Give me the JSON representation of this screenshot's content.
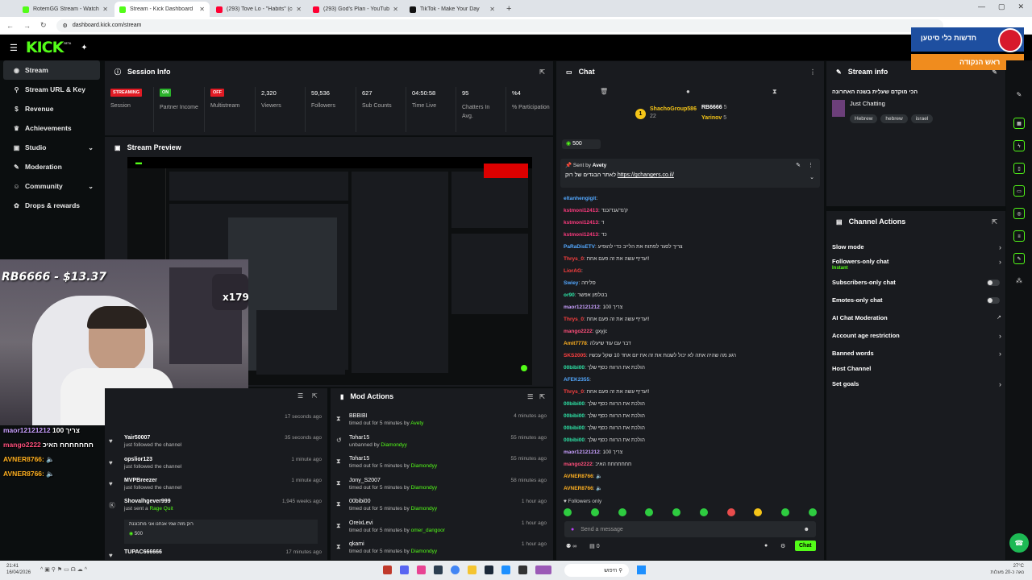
{
  "browser": {
    "tabs": [
      {
        "title": "RotemGG Stream - Watch Live",
        "color": "#53fc18"
      },
      {
        "title": "Stream - Kick Dashboard",
        "color": "#53fc18"
      },
      {
        "title": "(293) Tove Lo - \"Habits\" (cove",
        "color": "#ff0033"
      },
      {
        "title": "(293) God's Plan - YouTube",
        "color": "#ff0033"
      },
      {
        "title": "TikTok - Make Your Day",
        "color": "#111111"
      }
    ],
    "new_tab": "+",
    "url": "dashboard.kick.com/stream"
  },
  "header": {
    "logo": "KICK",
    "logo_beta": "BETA"
  },
  "sidebar": {
    "items": [
      {
        "label": "Stream",
        "icon": "broadcast-icon",
        "glyph": "◉"
      },
      {
        "label": "Stream URL & Key",
        "icon": "key-icon",
        "glyph": "⚲"
      },
      {
        "label": "Revenue",
        "icon": "money-icon",
        "glyph": "$"
      },
      {
        "label": "Achievements",
        "icon": "trophy-icon",
        "glyph": "♛"
      },
      {
        "label": "Studio",
        "icon": "studio-icon",
        "glyph": "▣"
      },
      {
        "label": "Moderation",
        "icon": "sword-icon",
        "glyph": "✎"
      },
      {
        "label": "Community",
        "icon": "people-icon",
        "glyph": "☺"
      },
      {
        "label": "Drops & rewards",
        "icon": "gift-icon",
        "glyph": "✿"
      }
    ]
  },
  "session": {
    "title": "Session Info",
    "stats": [
      {
        "badge": "STREAMING",
        "badge_color": "#e01b24",
        "label": "Session"
      },
      {
        "badge": "ON",
        "badge_color": "#2bb32b",
        "label": "Partner Income"
      },
      {
        "badge": "OFF",
        "badge_color": "#e01b24",
        "label": "Multistream"
      },
      {
        "value": "2,320",
        "label": "Viewers"
      },
      {
        "value": "59,536",
        "label": "Followers"
      },
      {
        "value": "627",
        "label": "Sub Counts"
      },
      {
        "value": "04:50:58",
        "label": "Time Live"
      },
      {
        "value": "95",
        "label": "Chatters In Avg."
      },
      {
        "value": "%4",
        "label": "% Participation"
      }
    ]
  },
  "preview": {
    "title": "Stream Preview"
  },
  "webcam": {
    "overlay": "RB6666 - $13.37",
    "counter": "x1792"
  },
  "activity": {
    "overlay_chat": [
      {
        "user": "maor12121212",
        "text": "100 צריך",
        "color": "#c9a0ff"
      },
      {
        "user": "mango2222",
        "text": "חחחחחחח האיכ",
        "color": "#ff4f7b"
      },
      {
        "user": "AVNER8766:",
        "text": "🔈",
        "color": "#ffb020"
      },
      {
        "user": "AVNER8766:",
        "text": "🔈",
        "color": "#ffb020"
      }
    ],
    "items": [
      {
        "name": "",
        "sub": "",
        "time": "17 seconds ago"
      },
      {
        "name": "Yair50007",
        "sub": "just followed the channel",
        "time": "35 seconds ago"
      },
      {
        "name": "opslior123",
        "sub": "just followed the channel",
        "time": "1 minute ago"
      },
      {
        "name": "MVPBreezer",
        "sub": "just followed the channel",
        "time": "1 minute ago"
      },
      {
        "name": "Shovalhgever999",
        "sub": "just sent a",
        "gift": "Rage Quit",
        "time": "1,945 weeks ago"
      },
      {
        "name": "TUPAC666666",
        "sub": "",
        "time": "17 minutes ago"
      }
    ],
    "gift_message": "רוק מזה שמי אנחנו אני מתכוננת",
    "gift_amount": "500"
  },
  "mod_actions": {
    "title": "Mod Actions",
    "items": [
      {
        "name": "BBBIBI",
        "sub": "timed out for 5 minutes by",
        "by": "Avety",
        "time": "4 minutes ago",
        "icon": "hourglass-icon"
      },
      {
        "name": "Tohar15",
        "sub": "unbanned by",
        "by": "Diamondyy",
        "time": "55 minutes ago",
        "icon": "undo-icon"
      },
      {
        "name": "Tohar15",
        "sub": "timed out for 5 minutes by",
        "by": "Diamondyy",
        "time": "55 minutes ago",
        "icon": "hourglass-icon"
      },
      {
        "name": "Jony_S2007",
        "sub": "timed out for 5 minutes by",
        "by": "Diamondyy",
        "time": "58 minutes ago",
        "icon": "hourglass-icon"
      },
      {
        "name": "00bibi00",
        "sub": "timed out for 5 minutes by",
        "by": "Diamondyy",
        "time": "1 hour ago",
        "icon": "hourglass-icon"
      },
      {
        "name": "OreixLevi",
        "sub": "timed out for 5 minutes by",
        "by": "omer_dangoor",
        "time": "1 hour ago",
        "icon": "hourglass-icon"
      },
      {
        "name": "qkami",
        "sub": "timed out for 5 minutes by",
        "by": "Diamondyy",
        "time": "1 hour ago",
        "icon": "hourglass-icon"
      }
    ]
  },
  "chat": {
    "title": "Chat",
    "top_user1": "ShachoGroup586",
    "top_user1_count": "22",
    "top_user2": "RB6666",
    "top_user2_count": "5",
    "top_user3": "Yarinov",
    "top_user3_count": "5",
    "rank": "1",
    "pinned_amount": "500",
    "pinned_by_label": "Sent by",
    "pinned_by": "Avety",
    "pinned_text": "לאתר הבגדים של רוק",
    "pinned_link": "https://gchangers.co.il/",
    "messages": [
      {
        "user": "eltanhengigit",
        "text": "",
        "color": "#53a8ff"
      },
      {
        "user": "kstmoni12413",
        "text": "ק'נד/גנד/כנד",
        "color": "#ff3b7f"
      },
      {
        "user": "kstmoni12413",
        "text": "ד",
        "color": "#ff3b7f"
      },
      {
        "user": "kstmoni12413",
        "text": "כד",
        "color": "#ff3b7f"
      },
      {
        "user": "PaRaDisETV",
        "text": "צריך לסגר לפתוח את הלייב כדי להופיע",
        "color": "#53a8ff"
      },
      {
        "user": "Thrys_0",
        "text": "עדיף עשה את זה פעם אחת!!",
        "color": "#ff4040"
      },
      {
        "user": "LiorAG",
        "text": "",
        "color": "#ff4040"
      },
      {
        "user": "Swiey",
        "text": "סליחה",
        "color": "#53a8ff"
      },
      {
        "user": "or90",
        "text": "בטלפון אפשר",
        "color": "#2ee6a8"
      },
      {
        "user": "maor12121212",
        "text": "100 צריך",
        "color": "#c9a0ff"
      },
      {
        "user": "Thrys_0",
        "text": "עדיף עשה את זה פעם אחת!!",
        "color": "#ff4040"
      },
      {
        "user": "mango2222",
        "text": "gxyjc",
        "color": "#ff4f7b"
      },
      {
        "user": "Amit7778",
        "text": "דבר עם עוד שיעלה",
        "color": "#ffb020"
      },
      {
        "user": "SKS2005",
        "text": "רגע מה שהיה אתה לא יכול לשנות את זה את יום אחד 10 שקל עכשיו",
        "color": "#ff4040"
      },
      {
        "user": "00bibi00",
        "text": "הולכת את הרווח כסף שלך",
        "color": "#2ee6a8"
      },
      {
        "user": "AFEK2355",
        "text": "",
        "color": "#53a8ff"
      },
      {
        "user": "Thrys_0",
        "text": "עדיף עשה את זה פעם אחת!!",
        "color": "#ff4040"
      },
      {
        "user": "00bibi00",
        "text": "הולכת את הרווח כסף שלך",
        "color": "#2ee6a8"
      },
      {
        "user": "00bibi00",
        "text": "הולכת את הרווח כסף שלך",
        "color": "#2ee6a8"
      },
      {
        "user": "00bibi00",
        "text": "הולכת את הרווח כסף שלך",
        "color": "#2ee6a8"
      },
      {
        "user": "00bibi00",
        "text": "הולכת את הרווח כסף שלך",
        "color": "#2ee6a8"
      },
      {
        "user": "maor12121212",
        "text": "100 צריך",
        "color": "#c9a0ff"
      },
      {
        "user": "mango2222",
        "text": "חחחחחחח האיכ",
        "color": "#ff4f7b"
      },
      {
        "user": "AVNER8766",
        "text": "🔈",
        "color": "#ffb020"
      },
      {
        "user": "AVNER8766",
        "text": "🔈",
        "color": "#ffb020"
      }
    ],
    "followers_only": "Followers only",
    "placeholder": "Send a message",
    "viewers_count": "0",
    "chat_button": "Chat"
  },
  "stream_info": {
    "title": "Stream info",
    "stream_title": "הכי מוקדם שעלית בשנה האחרונה",
    "category": "Just Chatting",
    "tags": [
      "Hebrew",
      "hebrew",
      "israel"
    ]
  },
  "channel_actions": {
    "title": "Channel Actions",
    "items": [
      {
        "label": "Slow mode",
        "control": "chevron"
      },
      {
        "label": "Followers-only chat",
        "sub": "Instant",
        "control": "chevron"
      },
      {
        "label": "Subscribers-only chat",
        "control": "toggle"
      },
      {
        "label": "Emotes-only chat",
        "control": "toggle"
      },
      {
        "label": "AI Chat Moderation",
        "control": "external"
      },
      {
        "label": "Account age restriction",
        "control": "chevron"
      },
      {
        "label": "Banned words",
        "control": "chevron"
      },
      {
        "label": "Host Channel",
        "control": "none"
      },
      {
        "label": "Set goals",
        "control": "chevron"
      }
    ]
  },
  "news_widget": {
    "line1": "חדשות כלי סיטען",
    "line2": "ראש הנקודה"
  },
  "taskbar": {
    "time": "21:41",
    "date": "16/04/2026",
    "search": "חיפוש",
    "weather": "27°C",
    "weather_note": "נאה כ-20 מעלות",
    "lang": "ENG"
  }
}
